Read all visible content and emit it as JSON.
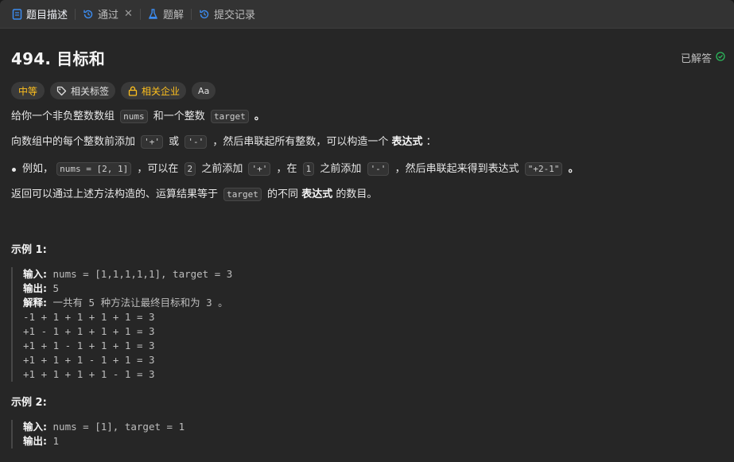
{
  "tabs": [
    {
      "label": "题目描述",
      "icon": "document-icon"
    },
    {
      "label": "通过",
      "icon": "history-icon"
    },
    {
      "label": "题解",
      "icon": "flask-icon"
    },
    {
      "label": "提交记录",
      "icon": "history-icon"
    }
  ],
  "problem": {
    "title": "494. 目标和",
    "solved_label": "已解答",
    "difficulty": "中等",
    "tags_label": "相关标签",
    "companies_label": "相关企业",
    "font_button_label": "Aa"
  },
  "description": {
    "p1_a": "给你一个非负整数数组",
    "p1_code1": "nums",
    "p1_b": "和一个整数",
    "p1_code2": "target",
    "p1_c": "。",
    "p2_a": "向数组中的每个整数前添加",
    "p2_code1": "'+'",
    "p2_b": "或",
    "p2_code2": "'-'",
    "p2_c": "，然后串联起所有整数，可以构造一个",
    "p2_bold": "表达式",
    "p2_d": "：",
    "b1_a": "例如，",
    "b1_code1": "nums = [2, 1]",
    "b1_b": "，可以在",
    "b1_code2": "2",
    "b1_c": "之前添加",
    "b1_code3": "'+'",
    "b1_d": "，在",
    "b1_code4": "1",
    "b1_e": "之前添加",
    "b1_code5": "'-'",
    "b1_f": "，然后串联起来得到表达式",
    "b1_code6": "\"+2-1\"",
    "b1_g": "。",
    "p3_a": "返回可以通过上述方法构造的、运算结果等于",
    "p3_code": "target",
    "p3_b": "的不同",
    "p3_bold": "表达式",
    "p3_c": "的数目。"
  },
  "examples": [
    {
      "title": "示例 1:",
      "input_label": "输入:",
      "input": "nums = [1,1,1,1,1], target = 3",
      "output_label": "输出:",
      "output": "5",
      "explain_label": "解释:",
      "explain": "一共有 5 种方法让最终目标和为 3 。",
      "lines": [
        "-1 + 1 + 1 + 1 + 1 = 3",
        "+1 - 1 + 1 + 1 + 1 = 3",
        "+1 + 1 - 1 + 1 + 1 = 3",
        "+1 + 1 + 1 - 1 + 1 = 3",
        "+1 + 1 + 1 + 1 - 1 = 3"
      ]
    },
    {
      "title": "示例 2:",
      "input_label": "输入:",
      "input": "nums = [1], target = 1",
      "output_label": "输出:",
      "output": "1"
    }
  ],
  "colors": {
    "background": "#262626",
    "tabbar": "#333333",
    "difficulty_medium": "#ffc01e",
    "solved_check": "#2cbb5d"
  }
}
